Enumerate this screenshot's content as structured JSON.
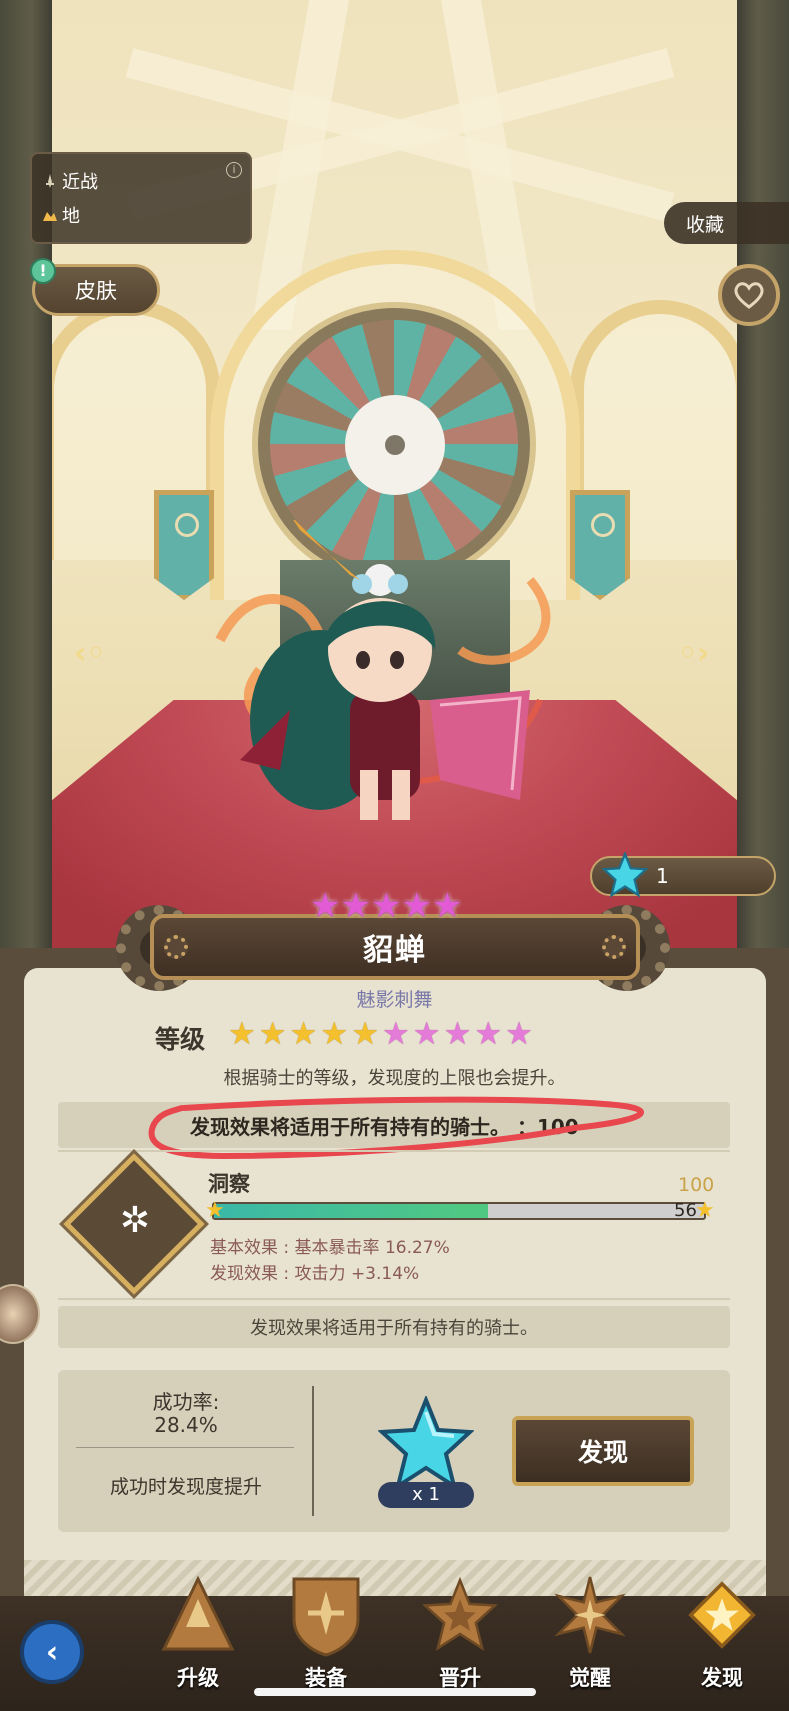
{
  "info_box": {
    "attack_type": "近战",
    "terrain": "地"
  },
  "skin_label": "皮肤",
  "collect_label": "收藏",
  "counter_value": "1",
  "top_stars": 5,
  "hero": {
    "name": "貂蝉",
    "subtitle": "魅影刺舞"
  },
  "level": {
    "label": "等级",
    "gold_stars": 5,
    "total_stars": 10,
    "description": "根据骑士的等级，发现度的上限也会提升。"
  },
  "highlight_text": "发现效果将适用于所有持有的骑士。 ：100",
  "stat": {
    "name": "洞察",
    "max": "100",
    "current": "56",
    "progress_fraction": 0.56,
    "basic_effect": "基本效果 : 基本暴击率 16.27%",
    "discovery_effect": "发现效果 : 攻击力 +3.14%"
  },
  "note_text": "发现效果将适用于所有持有的骑士。",
  "action": {
    "rate_label": "成功率:",
    "rate_value": "28.4%",
    "rate_desc": "成功时发现度提升",
    "cost_count": "x 1",
    "discover_label": "发现"
  },
  "tabs": [
    {
      "label": "升级",
      "icon": "level-up-icon",
      "active": false
    },
    {
      "label": "装备",
      "icon": "shield-icon",
      "active": false
    },
    {
      "label": "晋升",
      "icon": "star-rank-icon",
      "active": false
    },
    {
      "label": "觉醒",
      "icon": "awaken-icon",
      "active": false
    },
    {
      "label": "发现",
      "icon": "discover-icon",
      "active": true
    }
  ],
  "colors": {
    "panel": "#e8e3d1",
    "accent_gold": "#c9a355",
    "progress": "#4fc884",
    "highlight_ink": "#e8474d"
  }
}
